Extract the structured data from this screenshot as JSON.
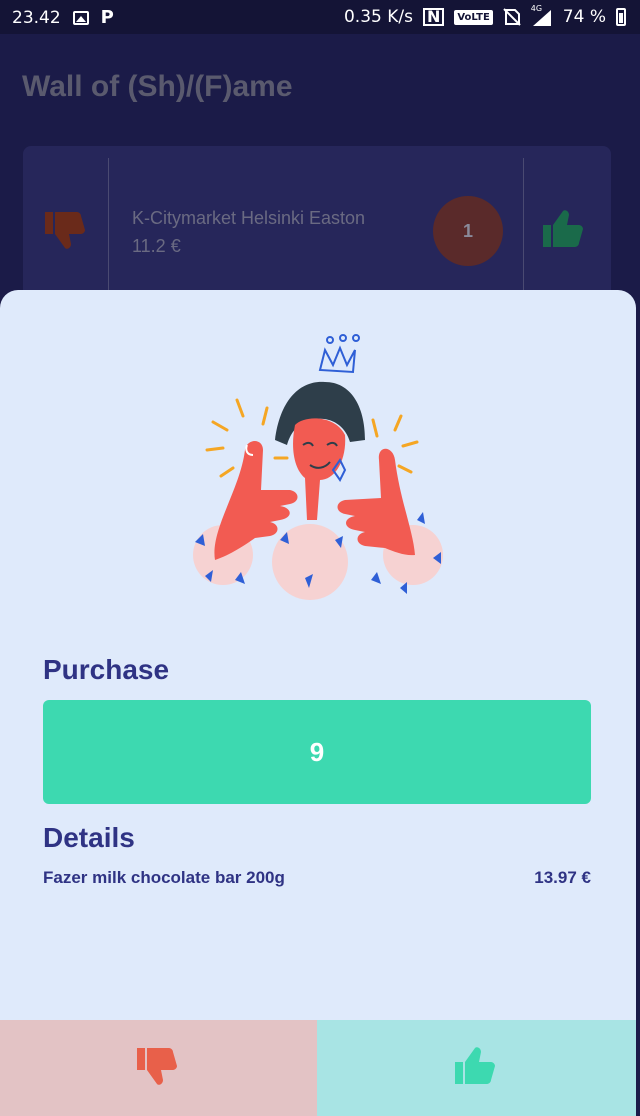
{
  "status_bar": {
    "time": "23.42",
    "speed": "0.35 K/s",
    "volte": "VoLTE",
    "network": "4G",
    "battery": "74 %"
  },
  "background": {
    "title": "Wall of (Sh)/(F)ame",
    "card": {
      "store": "K-Citymarket Helsinki Easton",
      "price": "11.2 €",
      "count": "1"
    }
  },
  "sheet": {
    "purchase_title": "Purchase",
    "purchase_value": "9",
    "details_title": "Details",
    "details": [
      {
        "name": "Fazer milk chocolate bar 200g",
        "price": "13.97 €"
      }
    ]
  },
  "colors": {
    "accent_green": "#3dd9b0",
    "title_blue": "#2f3384",
    "downvote": "#e8604a",
    "upvote": "#3dd9b0"
  },
  "icons": {
    "downvote": "thumbs-down-icon",
    "upvote": "thumbs-up-icon"
  }
}
